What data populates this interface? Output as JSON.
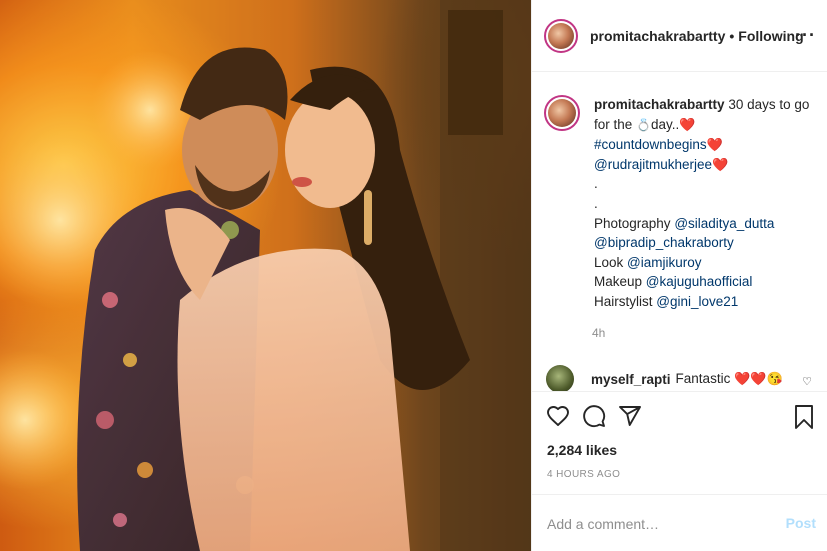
{
  "post": {
    "username": "promitachakrabartty",
    "separator": "•",
    "follow_status": "Following",
    "more_icon": "more-horizontal-icon"
  },
  "caption": {
    "username": "promitachakrabartty",
    "text_line1": "30 days to go for the",
    "ring_glyph": "💍",
    "text_line1_end": "day..",
    "heart": "❤️",
    "hashtag": "#countdownbegins",
    "mention_partner": "@rudrajitmukherjee",
    "dot1": ".",
    "dot2": ".",
    "photography_label": "Photography",
    "photography_handle1": "@siladitya_dutta",
    "photography_handle2": "@bipradip_chakraborty",
    "look_label": "Look",
    "look_handle": "@iamjikuroy",
    "makeup_label": "Makeup",
    "makeup_handle": "@kajuguhaofficial",
    "hair_label": "Hairstylist",
    "hair_handle": "@gini_love21",
    "time": "4h"
  },
  "comments": [
    {
      "username": "myself_rapti",
      "text": "Fantastic",
      "emojis": "❤️❤️😘"
    }
  ],
  "actions": {
    "icons": [
      "heart-icon",
      "comment-icon",
      "share-icon",
      "bookmark-icon"
    ]
  },
  "likes": "2,284 likes",
  "posted_ago": "4 HOURS AGO",
  "add_comment": {
    "placeholder": "Add a comment…",
    "post_label": "Post"
  },
  "colors": {
    "link": "#00376b",
    "heart_red": "#e0243a",
    "post_disabled": "#b2dffc",
    "story_ring": "#c13584"
  }
}
